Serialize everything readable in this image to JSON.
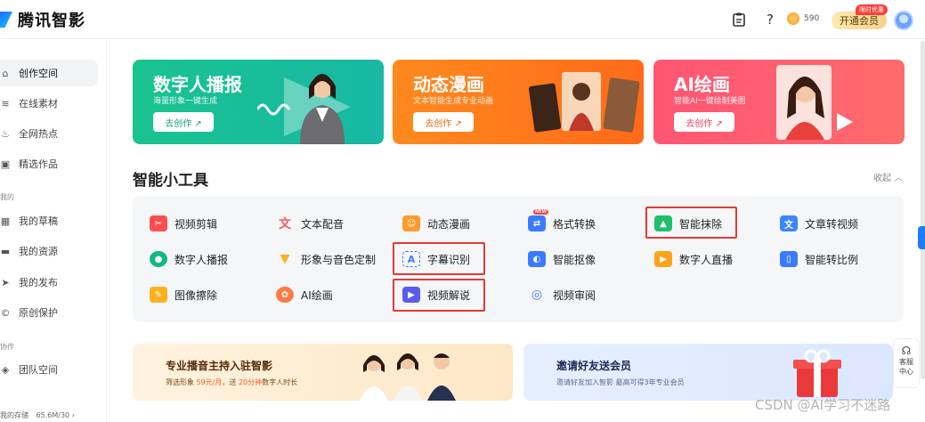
{
  "app": {
    "name": "腾讯智影"
  },
  "header": {
    "coins": "590",
    "vip_label": "开通会员",
    "vip_tag": "限时优惠"
  },
  "sidebar": {
    "items": [
      {
        "label": "创作空间",
        "icon": "home-icon",
        "active": true
      },
      {
        "label": "在线素材",
        "icon": "layers-icon"
      },
      {
        "label": "全网热点",
        "icon": "flame-icon"
      },
      {
        "label": "精选作品",
        "icon": "video-icon"
      }
    ],
    "section_mine": "我的",
    "mine_items": [
      {
        "label": "我的草稿",
        "icon": "grid-icon"
      },
      {
        "label": "我的资源",
        "icon": "folder-icon"
      },
      {
        "label": "我的发布",
        "icon": "send-icon"
      },
      {
        "label": "原创保护",
        "icon": "shield-icon"
      }
    ],
    "section_collab": "协作",
    "collab_items": [
      {
        "label": "团队空间",
        "icon": "cube-icon"
      }
    ],
    "storage_label": "我的存储",
    "storage_value": "65.6M/30"
  },
  "banners": [
    {
      "title": "数字人播报",
      "subtitle": "海量形象一键生成",
      "button": "去创作 ↗"
    },
    {
      "title": "动态漫画",
      "subtitle": "文本智能生成专业动画",
      "button": "去创作 ↗"
    },
    {
      "title": "AI绘画",
      "subtitle": "智能AI一键绘制美图",
      "button": "去创作 ↗"
    }
  ],
  "tools_section": {
    "title": "智能小工具",
    "collapse_label": "收起 ︿",
    "rows": [
      [
        {
          "label": "视频剪辑",
          "icon": "video-cut-icon",
          "color": "#ff4d4f"
        },
        {
          "label": "文本配音",
          "icon": "text-voice-icon",
          "color": "#ff5a5a"
        },
        {
          "label": "动态漫画",
          "icon": "comic-icon",
          "color": "#ff9a2e"
        },
        {
          "label": "格式转换",
          "icon": "format-convert-icon",
          "color": "#3a7bff",
          "badge": "NEW"
        },
        {
          "label": "智能抹除",
          "icon": "smart-erase-icon",
          "color": "#1fbf6b",
          "highlight": true
        },
        {
          "label": "文章转视频",
          "icon": "article-video-icon",
          "color": "#3a86ff"
        }
      ],
      [
        {
          "label": "数字人播报",
          "icon": "digital-human-icon",
          "color": "#12b886"
        },
        {
          "label": "形象与音色定制",
          "icon": "avatar-voice-icon",
          "color": "#ffb020"
        },
        {
          "label": "字幕识别",
          "icon": "subtitle-icon",
          "color": "#3a7bff",
          "highlight": true
        },
        {
          "label": "智能抠像",
          "icon": "matting-icon",
          "color": "#3a7bff"
        },
        {
          "label": "数字人直播",
          "icon": "live-icon",
          "color": "#ffa31a"
        },
        {
          "label": "智能转比例",
          "icon": "ratio-icon",
          "color": "#3a7bff"
        }
      ],
      [
        {
          "label": "图像擦除",
          "icon": "image-erase-icon",
          "color": "#ffb020"
        },
        {
          "label": "AI绘画",
          "icon": "ai-paint-icon",
          "color": "#ff7a45"
        },
        {
          "label": "视频解说",
          "icon": "video-explain-icon",
          "color": "#5b5bf0",
          "highlight": true
        },
        {
          "label": "视频审阅",
          "icon": "video-review-icon",
          "color": "#3a7bff"
        }
      ]
    ]
  },
  "promos": [
    {
      "title": "专业播音主持入驻智影",
      "subtitle_a": "筛选形象",
      "price": "59元/月",
      "subtitle_b": "，送",
      "minutes": "20分钟",
      "subtitle_c": "数字人时长"
    },
    {
      "title": "邀请好友送会员",
      "subtitle": "邀请好友加入智影 最高可得3年专业会员"
    }
  ],
  "service": {
    "line1": "客服",
    "line2": "中心"
  },
  "watermark": "CSDN @AI学习不迷路"
}
